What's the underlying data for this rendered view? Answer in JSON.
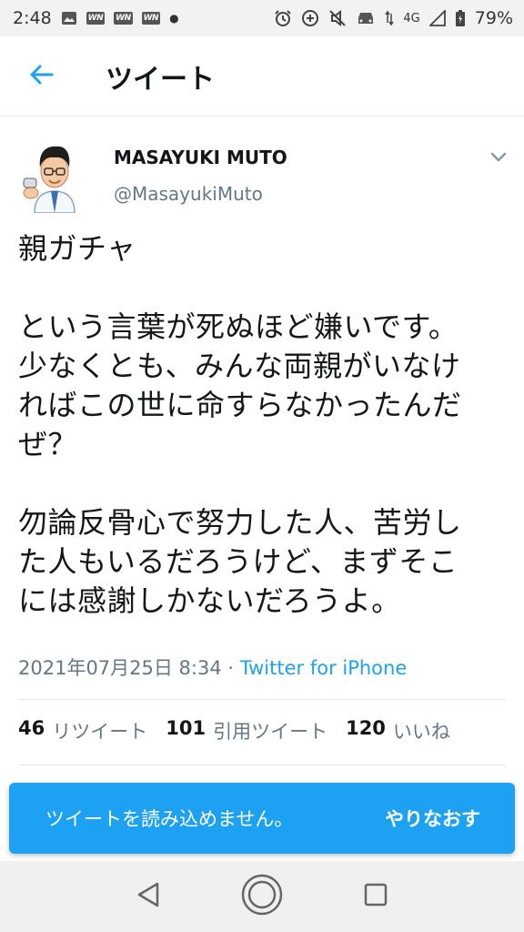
{
  "status_bar": {
    "time": "2:48",
    "notification_badges": [
      "WN",
      "WN",
      "WN"
    ],
    "network": "4G",
    "battery": "79%",
    "icons": [
      "image-icon",
      "wn-icon",
      "wn-icon",
      "wn-icon",
      "dot-icon",
      "alarm-icon",
      "data-saver-icon",
      "no-sound-icon",
      "car-icon",
      "wifi-arrows-icon",
      "signal-icon",
      "battery-charging-icon"
    ]
  },
  "app_bar": {
    "title": "ツイート",
    "back_icon": "arrow-left-icon"
  },
  "tweet": {
    "display_name": "MASAYUKI MUTO",
    "handle": "@MasayukiMuto",
    "body_lines": [
      "親ガチャ",
      "",
      "という言葉が死ぬほど嫌いです。",
      "少なくとも、みんな両親がいなけ",
      "ればこの世に命すらなかったんだ",
      "ぜ？",
      "",
      "勿論反骨心で努力した人、苦労し",
      "た人もいるだろうけど、まずそこ",
      "には感謝しかないだろうよ。"
    ],
    "timestamp": "2021年07月25日 8:34",
    "separator": " · ",
    "source": "Twitter for iPhone",
    "stats": [
      {
        "count": "46",
        "label": "リツイート"
      },
      {
        "count": "101",
        "label": "引用ツイート"
      },
      {
        "count": "120",
        "label": "いいね"
      }
    ]
  },
  "toast": {
    "message": "ツイートを読み込めません。",
    "action": "やりなおす"
  },
  "colors": {
    "accent": "#1da1f2",
    "text": "#14171a",
    "muted": "#657786",
    "divider": "#e1e8ed"
  }
}
